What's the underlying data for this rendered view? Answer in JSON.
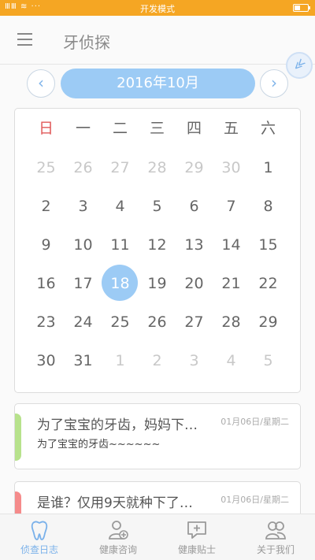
{
  "status_bar": {
    "signal_text": "ⅢⅢ ≋ ···",
    "mode": "开发模式"
  },
  "header": {
    "title": "牙侦探"
  },
  "month_nav": {
    "prev": "‹",
    "label": "2016年10月",
    "next": "›"
  },
  "calendar": {
    "weekdays": [
      "日",
      "一",
      "二",
      "三",
      "四",
      "五",
      "六"
    ],
    "weeks": [
      [
        "25",
        "26",
        "27",
        "28",
        "29",
        "30",
        "1"
      ],
      [
        "2",
        "3",
        "4",
        "5",
        "6",
        "7",
        "8"
      ],
      [
        "9",
        "10",
        "11",
        "12",
        "13",
        "14",
        "15"
      ],
      [
        "16",
        "17",
        "18",
        "19",
        "20",
        "21",
        "22"
      ],
      [
        "23",
        "24",
        "25",
        "26",
        "27",
        "28",
        "29"
      ],
      [
        "30",
        "31",
        "1",
        "2",
        "3",
        "4",
        "5"
      ]
    ],
    "selected": "18"
  },
  "notes": [
    {
      "title": "为了宝宝的牙齿，妈妈下…",
      "date": "01月06日/星期二",
      "subtitle": "为了宝宝的牙齿~~~~~~",
      "accent": "#b7e28c"
    },
    {
      "title": "是谁？仅用9天就种下了…",
      "date": "01月06日/星期二",
      "subtitle": "",
      "accent": "#f58b8b"
    }
  ],
  "tabs": [
    {
      "label": "侦查日志",
      "icon": "tooth-icon",
      "active": true
    },
    {
      "label": "健康咨询",
      "icon": "user-plus-icon",
      "active": false
    },
    {
      "label": "健康贴士",
      "icon": "chat-plus-icon",
      "active": false
    },
    {
      "label": "关于我们",
      "icon": "group-icon",
      "active": false
    }
  ],
  "colors": {
    "status_bar": "#f5a623",
    "accent_blue": "#9ccbf5",
    "sunday_red": "#e05a5a"
  }
}
